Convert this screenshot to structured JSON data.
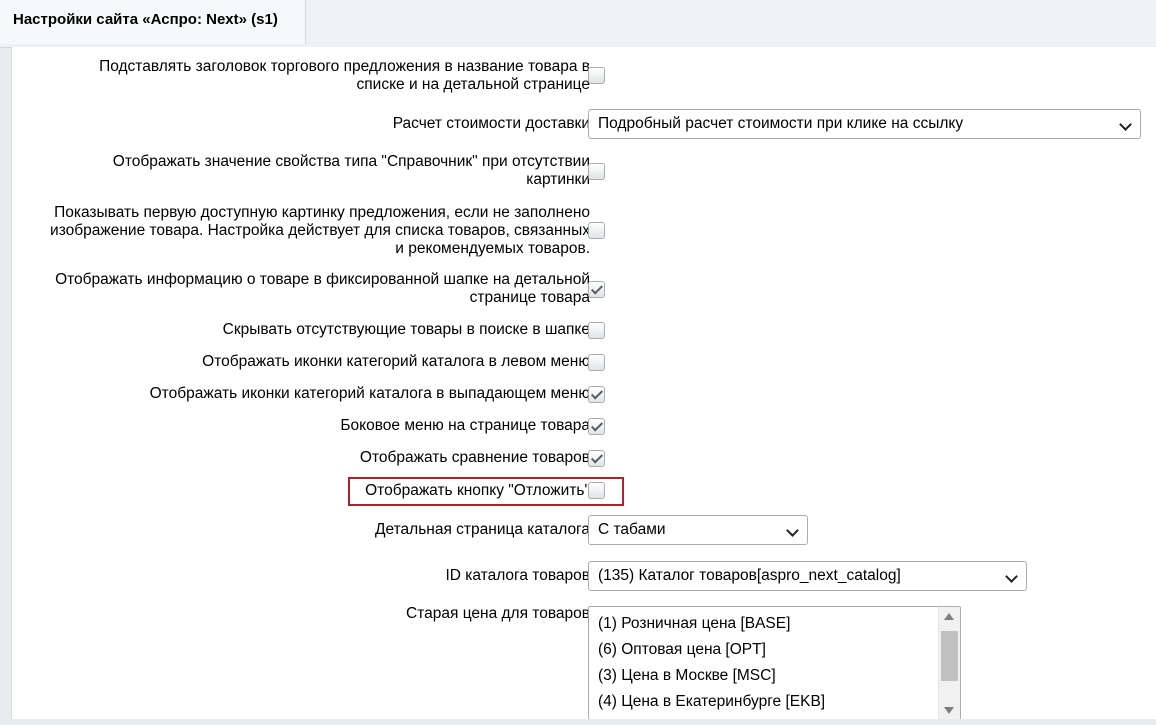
{
  "header": {
    "tab_title": "Настройки сайта «Аспро: Next» (s1)"
  },
  "settings": {
    "offer_title_label_1": "Подставлять заголовок торгового предложения в название товара в",
    "offer_title_label_2": "списке и на детальной странице",
    "delivery_label": "Расчет стоимости доставки",
    "delivery_value": "Подробный расчет стоимости при клике на ссылку",
    "directory_label_1": "Отображать значение свойства типа \"Справочник\" при отсутствии",
    "directory_label_2": "картинки",
    "first_image_label_1": "Показывать первую доступную картинку предложения, если не заполнено",
    "first_image_label_2": "изображение товара. Настройка действует для списка товаров, связанных",
    "first_image_label_3": "и рекомендуемых товаров.",
    "fixed_header_label_1": "Отображать информацию о товаре в фиксированной шапке на детальной",
    "fixed_header_label_2": "странице товара",
    "hide_missing_label": "Скрывать отсутствующие товары в поиске в шапке",
    "left_menu_icons_label": "Отображать иконки категорий каталога в левом меню",
    "dropdown_icons_label": "Отображать иконки категорий каталога в выпадающем меню",
    "side_menu_label": "Боковое меню на странице товара",
    "compare_label": "Отображать сравнение товаров",
    "delay_button_label": "Отображать кнопку \"Отложить\"",
    "catalog_detail_label": "Детальная страница каталога",
    "catalog_detail_value": "С табами",
    "catalog_id_label": "ID каталога товаров",
    "catalog_id_value": "(135) Каталог товаров[aspro_next_catalog]",
    "old_price_label": "Старая цена для товаров",
    "old_price_options": [
      "(1) Розничная цена [BASE]",
      "(6) Оптовая цена [OPT]",
      "(3) Цена в Москве [MSC]",
      "(4) Цена в Екатеринбурге [EKB]"
    ]
  },
  "checkbox_states": {
    "offer_title": false,
    "directory": false,
    "first_image": false,
    "fixed_header": true,
    "hide_missing": false,
    "left_menu_icons": false,
    "dropdown_icons": true,
    "side_menu": true,
    "compare": true,
    "delay_button": false
  },
  "colors": {
    "highlight": "#b02127"
  }
}
